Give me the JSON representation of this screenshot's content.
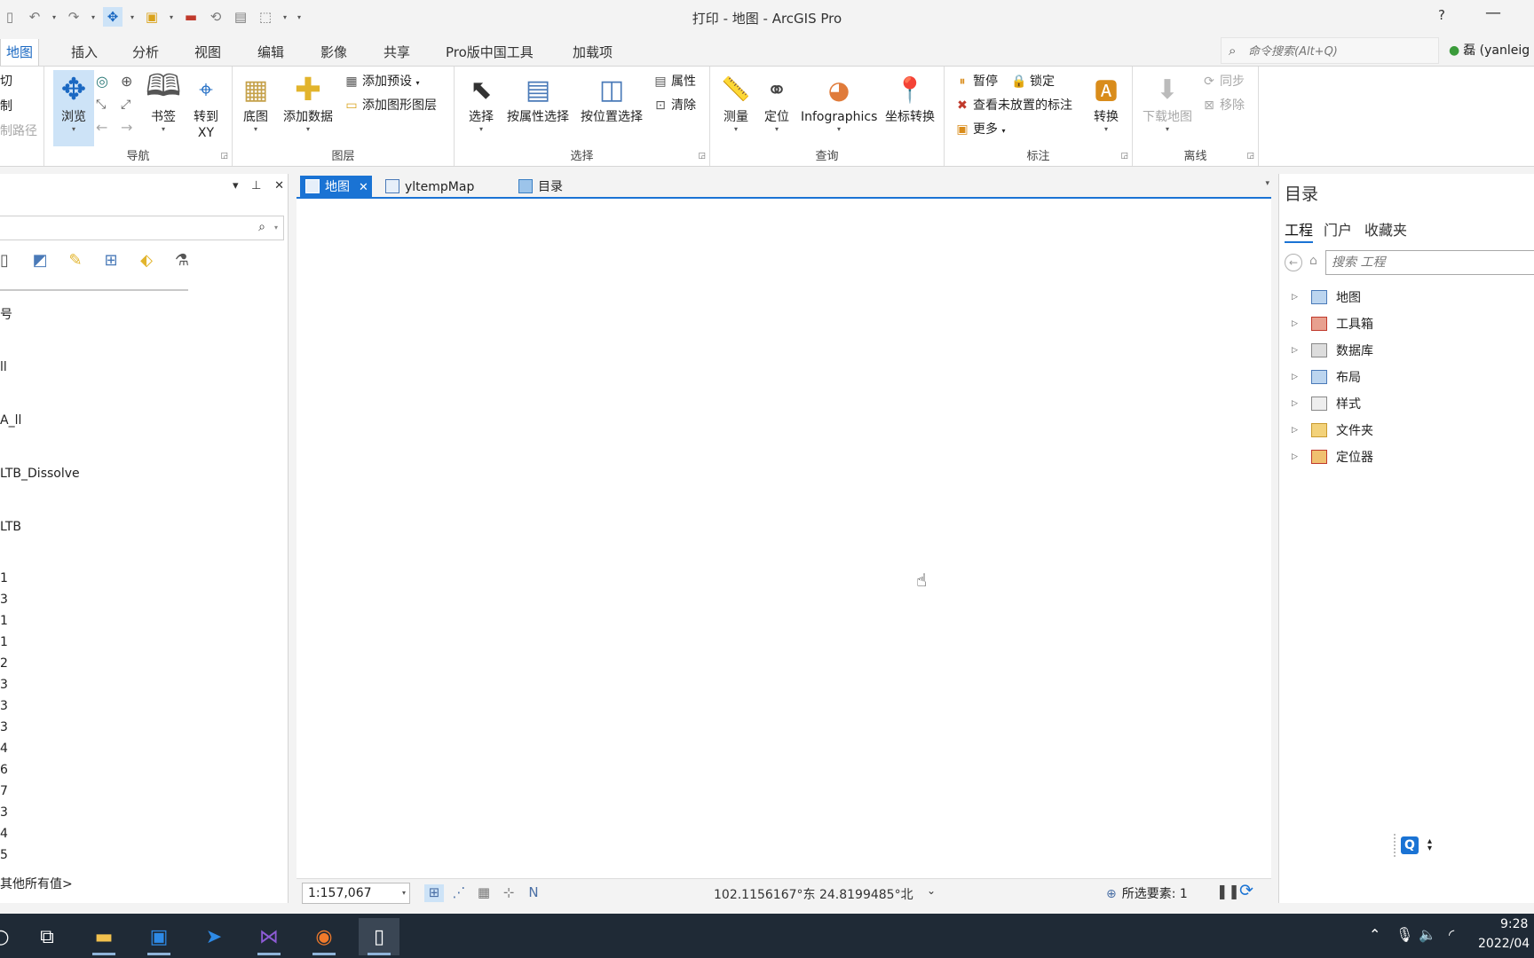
{
  "window": {
    "title": "打印 - 地图 - ArcGIS Pro",
    "help": "?",
    "minimize": "—"
  },
  "ribbon_tabs": [
    "地图",
    "插入",
    "分析",
    "视图",
    "编辑",
    "影像",
    "共享",
    "Pro版中国工具",
    "加载项"
  ],
  "command_search": {
    "placeholder": "命令搜索(Alt+Q)"
  },
  "user": {
    "label": "磊 (yanleig"
  },
  "ribbon": {
    "clipboard_partial": [
      "切",
      "制",
      "制路径"
    ],
    "navigate": {
      "browse": "浏览",
      "bookmark": "书签",
      "goto_xy_1": "转到",
      "goto_xy_2": "XY",
      "label": "导航"
    },
    "layer": {
      "basemap": "底图",
      "add_data": "添加数据",
      "add_preset": "添加预设",
      "add_graphics_layer": "添加图形图层",
      "label": "图层"
    },
    "selection": {
      "select": "选择",
      "select_by_attr": "按属性选择",
      "select_by_loc": "按位置选择",
      "attributes": "属性",
      "clear": "清除",
      "label": "选择"
    },
    "inquiry": {
      "measure": "测量",
      "locate": "定位",
      "infographics": "Infographics",
      "coord_convert": "坐标转换",
      "label": "查询"
    },
    "labeling": {
      "pause": "暂停",
      "lock": "锁定",
      "view_unplaced": "查看未放置的标注",
      "more": "更多",
      "convert": "转换",
      "label": "标注"
    },
    "offline": {
      "download_map": "下载地图",
      "sync": "同步",
      "remove": "移除",
      "label": "离线"
    }
  },
  "contents": {
    "labels": [
      "号",
      "ll",
      "A_ll",
      "LTB_Dissolve",
      "LTB",
      "1",
      "3",
      "1",
      "1",
      "2",
      "3",
      "3",
      "3",
      "4",
      "6",
      "7",
      "3",
      "4",
      "5",
      "其他所有值>"
    ]
  },
  "map_tabs": [
    {
      "label": "地图",
      "active": true
    },
    {
      "label": "yltempMap",
      "active": false
    },
    {
      "label": "目录",
      "active": false
    }
  ],
  "status": {
    "scale": "1:157,067",
    "coords": "102.1156167°东 24.8199485°北",
    "selected": "所选要素: 1"
  },
  "catalog": {
    "title": "目录",
    "tabs": [
      "工程",
      "门户",
      "收藏夹"
    ],
    "search_placeholder": "搜索 工程",
    "tree": [
      "地图",
      "工具箱",
      "数据库",
      "布局",
      "样式",
      "文件夹",
      "定位器"
    ]
  },
  "taskbar": {
    "time": "9:28",
    "date": "2022/04"
  },
  "colors": {
    "accent": "#1a73d4",
    "taskbar": "#1f2a36"
  }
}
